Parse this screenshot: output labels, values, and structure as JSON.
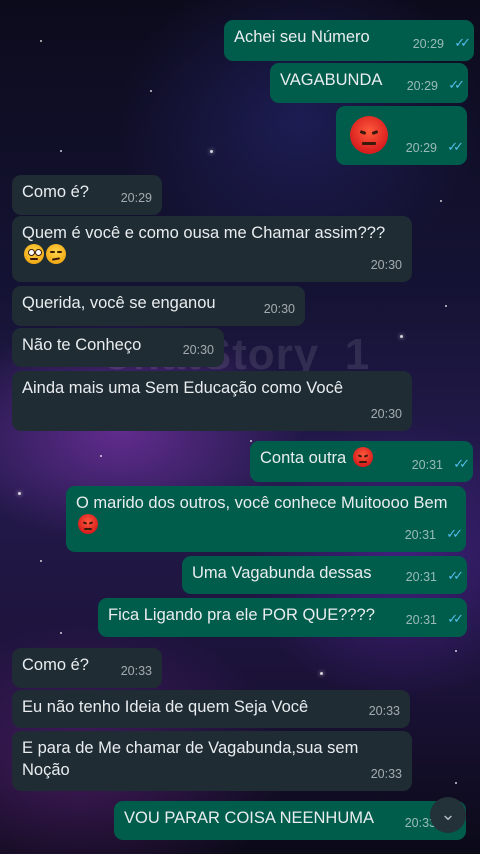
{
  "watermark": "ChatStory_1",
  "messages": [
    {
      "dir": "out",
      "text": "Achei seu Número",
      "time": "20:29"
    },
    {
      "dir": "out",
      "text": "VAGABUNDA",
      "time": "20:29"
    },
    {
      "dir": "out",
      "text": "",
      "emoji": "angry-face-emoji",
      "time": "20:29"
    },
    {
      "dir": "in",
      "text": "Como é?",
      "time": "20:29"
    },
    {
      "dir": "in",
      "text": "Quem é você e como ousa me Chamar assim???",
      "emoji": "eye-roll-emoji,unamused-face-emoji",
      "time": "20:30"
    },
    {
      "dir": "in",
      "text": "Querida, você se enganou",
      "time": "20:30"
    },
    {
      "dir": "in",
      "text": "Não te Conheço",
      "time": "20:30"
    },
    {
      "dir": "in",
      "text": "Ainda mais uma Sem Educação como Você",
      "time": "20:30"
    },
    {
      "dir": "out",
      "text": "Conta outra",
      "emoji": "angry-face-emoji",
      "time": "20:31"
    },
    {
      "dir": "out",
      "text": "O marido dos outros, você conhece Muitoooo Bem",
      "emoji": "angry-face-emoji",
      "time": "20:31"
    },
    {
      "dir": "out",
      "text": "Uma Vagabunda dessas",
      "time": "20:31"
    },
    {
      "dir": "out",
      "text": "Fica Ligando pra ele POR QUE????",
      "time": "20:31"
    },
    {
      "dir": "in",
      "text": "Como é?",
      "time": "20:33"
    },
    {
      "dir": "in",
      "text": "Eu não tenho Ideia de quem Seja Você",
      "time": "20:33"
    },
    {
      "dir": "in",
      "text": "E para de Me chamar de Vagabunda,sua sem Noção",
      "time": "20:33"
    },
    {
      "dir": "out",
      "text": "VOU PARAR COISA NEENHUMA",
      "time": "20:33"
    }
  ],
  "read_receipt": "double-check-blue-icon",
  "scroll_button": "chevron-down-icon",
  "colors": {
    "incoming": "#1f2c34",
    "outgoing": "#005c4b",
    "ticks": "#53bdeb"
  }
}
